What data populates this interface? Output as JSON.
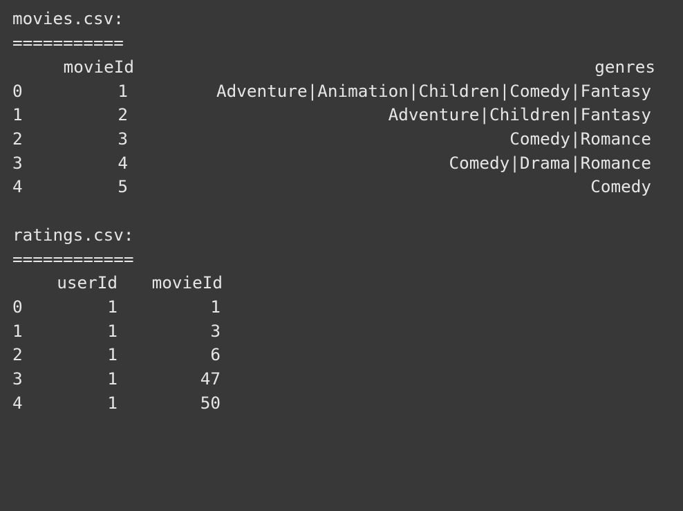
{
  "movies": {
    "title": "movies.csv:",
    "underline": "===========",
    "columns": [
      "movieId",
      "genres"
    ],
    "rows": [
      {
        "index": "0",
        "movieId": "1",
        "genres": "Adventure|Animation|Children|Comedy|Fantasy"
      },
      {
        "index": "1",
        "movieId": "2",
        "genres": "Adventure|Children|Fantasy"
      },
      {
        "index": "2",
        "movieId": "3",
        "genres": "Comedy|Romance"
      },
      {
        "index": "3",
        "movieId": "4",
        "genres": "Comedy|Drama|Romance"
      },
      {
        "index": "4",
        "movieId": "5",
        "genres": "Comedy"
      }
    ]
  },
  "ratings": {
    "title": "ratings.csv:",
    "underline": "============",
    "columns": [
      "userId",
      "movieId"
    ],
    "rows": [
      {
        "index": "0",
        "userId": "1",
        "movieId": "1"
      },
      {
        "index": "1",
        "userId": "1",
        "movieId": "3"
      },
      {
        "index": "2",
        "userId": "1",
        "movieId": "6"
      },
      {
        "index": "3",
        "userId": "1",
        "movieId": "47"
      },
      {
        "index": "4",
        "userId": "1",
        "movieId": "50"
      }
    ]
  }
}
